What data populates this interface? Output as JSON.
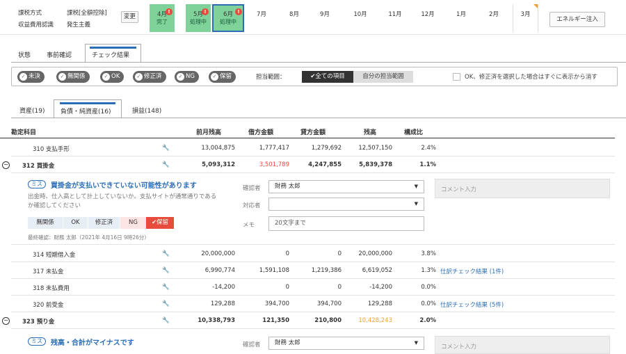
{
  "settings": {
    "tax_label": "課税方式",
    "tax_value": "課税[全額控除]",
    "revenue_label": "収益費用認識",
    "revenue_value": "発生主義",
    "change_button": "変更"
  },
  "months": [
    {
      "label": "4月",
      "status": "完了",
      "alert": true,
      "color": "green",
      "selected": false
    },
    {
      "label": "5月",
      "status": "処理中",
      "alert": true,
      "color": "green",
      "selected": false
    },
    {
      "label": "6月",
      "status": "処理中",
      "alert": true,
      "color": "green",
      "selected": true
    },
    {
      "label": "7月",
      "status": "",
      "alert": false
    },
    {
      "label": "8月",
      "status": "",
      "alert": false
    },
    {
      "label": "9月",
      "status": "",
      "alert": false
    },
    {
      "label": "10月",
      "status": "",
      "alert": false
    },
    {
      "label": "11月",
      "status": "",
      "alert": false
    },
    {
      "label": "12月",
      "status": "",
      "alert": false
    },
    {
      "label": "1月",
      "status": "",
      "alert": false
    },
    {
      "label": "2月",
      "status": "",
      "alert": false
    },
    {
      "label": "3月",
      "status": "",
      "alert": false
    }
  ],
  "energy_button": "エネルギー注入",
  "tabs": [
    "状態",
    "事前確認",
    "チェック結果"
  ],
  "filters": [
    "未決",
    "無関係",
    "OK",
    "修正済",
    "NG",
    "保留"
  ],
  "scope": {
    "label": "担当範囲：",
    "all": "✔全ての項目",
    "mine": "自分の担当範囲"
  },
  "hide_option": "OK、修正済を選択した場合はすぐに表示から消す",
  "account_tabs": [
    "資産(19)",
    "負債・純資産(16)",
    "損益(148)"
  ],
  "columns": [
    "勘定科目",
    "前月残高",
    "借方金額",
    "貸方金額",
    "残高",
    "構成比"
  ],
  "rows": [
    {
      "name": "310 支払手形",
      "prev": "13,004,875",
      "debit": "1,777,417",
      "credit": "1,279,692",
      "balance": "12,507,150",
      "ratio": "2.4%",
      "link": ""
    },
    {
      "name": "312 買掛金",
      "prev": "5,093,312",
      "debit": "3,501,789",
      "credit": "4,247,855",
      "balance": "5,839,378",
      "ratio": "1.1%",
      "link": ""
    },
    {
      "name": "314 短期借入金",
      "prev": "20,000,000",
      "debit": "0",
      "credit": "0",
      "balance": "20,000,000",
      "ratio": "3.8%",
      "link": ""
    },
    {
      "name": "317 未払金",
      "prev": "6,990,774",
      "debit": "1,591,108",
      "credit": "1,219,386",
      "balance": "6,619,052",
      "ratio": "1.3%",
      "link": "仕訳チェック結果 (1件)"
    },
    {
      "name": "318 未払費用",
      "prev": "-14,200",
      "debit": "0",
      "credit": "0",
      "balance": "-14,200",
      "ratio": "0.0%",
      "link": ""
    },
    {
      "name": "320 前受金",
      "prev": "129,288",
      "debit": "394,700",
      "credit": "394,700",
      "balance": "129,288",
      "ratio": "0.0%",
      "link": "仕訳チェック結果 (5件)"
    },
    {
      "name": "323 預り金",
      "prev": "10,338,793",
      "debit": "121,350",
      "credit": "210,800",
      "balance": "10,428,243",
      "ratio": "2.0%",
      "link": ""
    }
  ],
  "issue1": {
    "tag": "ミス",
    "title": "買掛金が支払いできていない可能性があります",
    "desc1": "出金時、仕入高として計上していないか。支払サイトが通常通りである",
    "desc2": "か確認してください",
    "status_buttons": [
      "無関係",
      "OK",
      "修正済",
      "NG",
      "✔保留"
    ],
    "last_check": "最終確認：財務 太郎（2021年 4月16日 9時26分）",
    "confirmer_label": "確認者",
    "confirmer_value": "財務 太郎",
    "handler_label": "対応者",
    "handler_value": "",
    "memo_label": "メモ",
    "memo_placeholder": "20文字まで",
    "comment_placeholder": "コメント入力"
  },
  "issue2": {
    "tag": "ミス",
    "title": "残高・合計がマイナスです",
    "confirmer_label": "確認者",
    "confirmer_value": "財務 太郎",
    "comment_placeholder": "コメント入力"
  },
  "colors": {
    "accent": "#2a6db5",
    "red": "#e74c3c",
    "orange": "#f0a030",
    "month_green": "#7fd39a"
  }
}
